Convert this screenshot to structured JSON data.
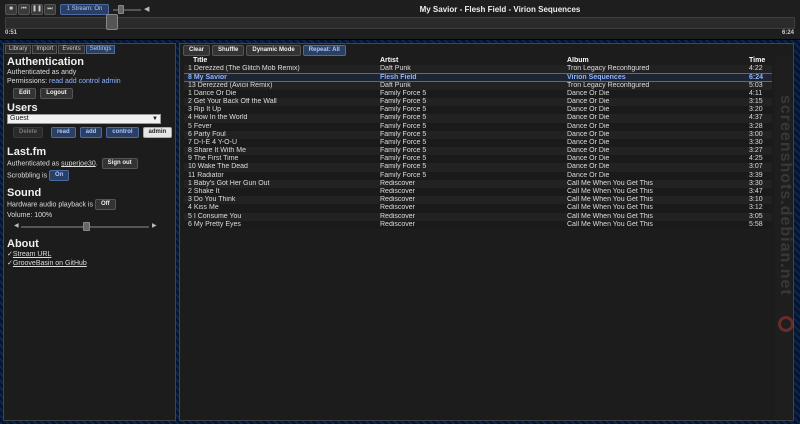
{
  "player": {
    "controls": [
      {
        "name": "stop-button",
        "glyph": "■"
      },
      {
        "name": "previous-button",
        "glyph": "⏮"
      },
      {
        "name": "play-pause-button",
        "glyph": "❚❚"
      },
      {
        "name": "next-button",
        "glyph": "⏭"
      }
    ],
    "stream_label": "1 Stream: On",
    "volume_icon": "◀",
    "now_playing": "My Savior - Flesh Field - Virion Sequences",
    "elapsed": "0:51",
    "total": "6:24",
    "progress": 0.133
  },
  "tabs": [
    {
      "label": "Library",
      "active": false
    },
    {
      "label": "Import",
      "active": false
    },
    {
      "label": "Events",
      "active": false
    },
    {
      "label": "Settings",
      "active": true
    }
  ],
  "settings": {
    "auth": {
      "title": "Authentication",
      "user_line": "Authenticated as andy",
      "perm_label": "Permissions:",
      "perms": [
        "read",
        "add",
        "control",
        "admin"
      ],
      "edit": "Edit",
      "logout": "Logout"
    },
    "users": {
      "title": "Users",
      "selected": "Guest",
      "arrow": "▼",
      "delete": "Delete",
      "read": "read",
      "add": "add",
      "control": "control",
      "admin": "admin"
    },
    "lastfm": {
      "title": "Last.fm",
      "auth_prefix": "Authenticated as",
      "username": "superjoe30",
      "auth_suffix": ".",
      "sign_out": "Sign out",
      "scrobbling": "Scrobbling is",
      "on": "On"
    },
    "sound": {
      "title": "Sound",
      "hw_label": "Hardware audio playback is",
      "off": "Off",
      "volume": "Volume: 100%",
      "left": "◀",
      "right": "▶"
    },
    "about": {
      "title": "About",
      "check": "✓",
      "links": [
        "Stream URL",
        "GrooveBasin on GitHub"
      ]
    }
  },
  "playlist": {
    "buttons": [
      {
        "label": "Clear",
        "name": "clear-button",
        "blue": false
      },
      {
        "label": "Shuffle",
        "name": "shuffle-button",
        "blue": false
      },
      {
        "label": "Dynamic Mode",
        "name": "dynamic-mode-button",
        "blue": false
      },
      {
        "label": "Repeat: All",
        "name": "repeat-button",
        "blue": true
      }
    ],
    "columns": {
      "title": "Title",
      "artist": "Artist",
      "album": "Album",
      "time": "Time"
    },
    "rows": [
      {
        "title": "1 Derezzed (The Glitch Mob Remix)",
        "artist": "Daft Punk",
        "album": "Tron Legacy Reconfigured",
        "time": "4:22"
      },
      {
        "title": "8 My Savior",
        "artist": "Flesh Field",
        "album": "Virion Sequences",
        "time": "6:24",
        "playing": true
      },
      {
        "title": "13 Derezzed (Avicii Remix)",
        "artist": "Daft Punk",
        "album": "Tron Legacy Reconfigured",
        "time": "5:03"
      },
      {
        "title": "1 Dance Or Die",
        "artist": "Family Force 5",
        "album": "Dance Or Die",
        "time": "4:11"
      },
      {
        "title": "2 Get Your Back Off the Wall",
        "artist": "Family Force 5",
        "album": "Dance Or Die",
        "time": "3:15"
      },
      {
        "title": "3 Rip It Up",
        "artist": "Family Force 5",
        "album": "Dance Or Die",
        "time": "3:20"
      },
      {
        "title": "4 How In the World",
        "artist": "Family Force 5",
        "album": "Dance Or Die",
        "time": "4:37"
      },
      {
        "title": "5 Fever",
        "artist": "Family Force 5",
        "album": "Dance Or Die",
        "time": "3:28"
      },
      {
        "title": "6 Party Foul",
        "artist": "Family Force 5",
        "album": "Dance Or Die",
        "time": "3:00"
      },
      {
        "title": "7 D-I-E 4 Y-O-U",
        "artist": "Family Force 5",
        "album": "Dance Or Die",
        "time": "3:30"
      },
      {
        "title": "8 Share It With Me",
        "artist": "Family Force 5",
        "album": "Dance Or Die",
        "time": "3:27"
      },
      {
        "title": "9 The First Time",
        "artist": "Family Force 5",
        "album": "Dance Or Die",
        "time": "4:25"
      },
      {
        "title": "10 Wake The Dead",
        "artist": "Family Force 5",
        "album": "Dance Or Die",
        "time": "3:07"
      },
      {
        "title": "11 Radiator",
        "artist": "Family Force 5",
        "album": "Dance Or Die",
        "time": "3:39"
      },
      {
        "title": "1 Baby's Got Her Gun Out",
        "artist": "Rediscover",
        "album": "Call Me When You Get This",
        "time": "3:30"
      },
      {
        "title": "2 Shake It",
        "artist": "Rediscover",
        "album": "Call Me When You Get This",
        "time": "3:47"
      },
      {
        "title": "3 Do You Think",
        "artist": "Rediscover",
        "album": "Call Me When You Get This",
        "time": "3:10"
      },
      {
        "title": "4 Kiss Me",
        "artist": "Rediscover",
        "album": "Call Me When You Get This",
        "time": "3:12"
      },
      {
        "title": "5 I Consume You",
        "artist": "Rediscover",
        "album": "Call Me When You Get This",
        "time": "3:05"
      },
      {
        "title": "6 My Pretty Eyes",
        "artist": "Rediscover",
        "album": "Call Me When You Get This",
        "time": "5:58"
      }
    ]
  },
  "watermark": "screenshots.debian.net",
  "colors": {
    "accent": "#8fb3ff",
    "button_blue": "#2b3f63",
    "panel": "#1c1c1c"
  }
}
